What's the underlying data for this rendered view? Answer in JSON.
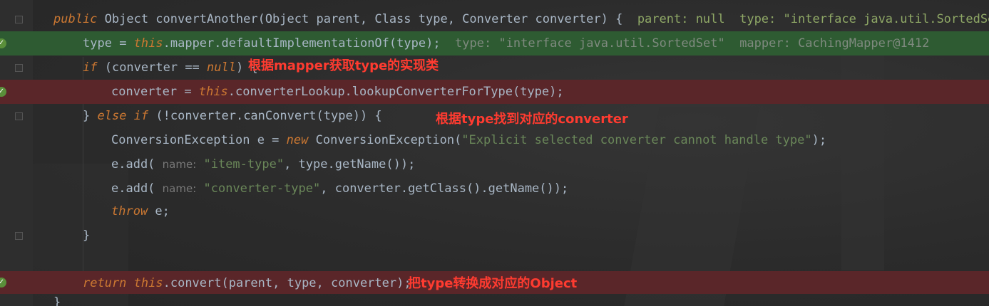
{
  "lines": [
    {
      "prefix": "",
      "kw1": "public",
      "rest": " Object convertAnother(Object parent, Class type, Converter converter) {",
      "debug": "  parent: null  type: \"interface java.util.SortedSet\""
    },
    {
      "t1": "type ",
      "eq": "= ",
      "kw": "this",
      "t2": ".mapper.defaultImplementationOf(type);",
      "debug": "  type: \"interface java.util.SortedSet\"  mapper: CachingMapper@1412"
    },
    {
      "kw": "if",
      "t1": " (converter ",
      "eq": "==",
      "t2": " ",
      "kw2": "null",
      "t3": ") {"
    },
    {
      "t1": "converter ",
      "eq": "= ",
      "kw": "this",
      "t2": ".converterLookup.lookupConverterForType(type);"
    },
    {
      "t0": "} ",
      "kw": "else if",
      "t1": " (!converter.canConvert(type)) {"
    },
    {
      "t1": "ConversionException e ",
      "eq": "= ",
      "kw": "new",
      "t2": " ConversionException(",
      "str": "\"Explicit selected converter cannot handle type\"",
      "t3": ");"
    },
    {
      "t1": "e.add( ",
      "hint": "name:",
      "str": " \"item-type\"",
      "t2": ", type.getName());"
    },
    {
      "t1": "e.add( ",
      "hint": "name:",
      "str": " \"converter-type\"",
      "t2": ", converter.getClass().getName());"
    },
    {
      "kw": "throw",
      "t1": " e;"
    },
    {
      "t1": "}"
    },
    {
      "t1": ""
    },
    {
      "kw": "return",
      "kw2": " this",
      "t1": ".convert(parent, type, converter);"
    },
    {
      "t1": "}"
    }
  ],
  "annotations": {
    "mapper_note": "根据mapper获取type的实现类",
    "converter_note": "根据type找到对应的converter",
    "return_note": "把type转换成对应的Object"
  }
}
